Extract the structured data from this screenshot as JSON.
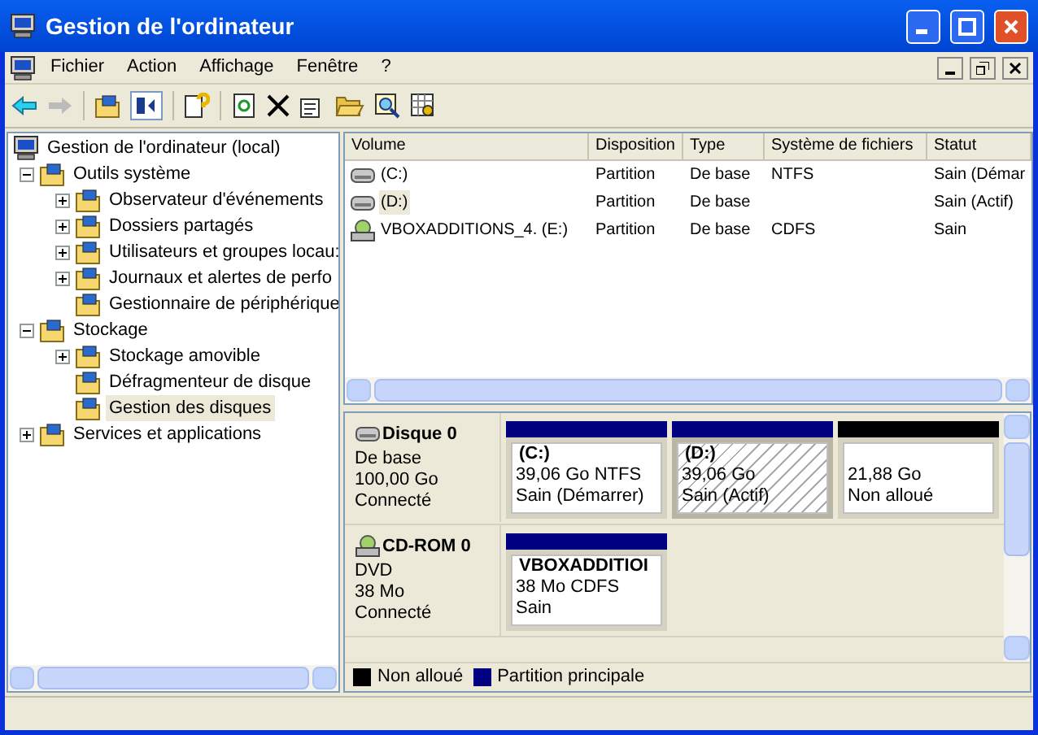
{
  "window": {
    "title": "Gestion de l'ordinateur"
  },
  "menu": [
    "Fichier",
    "Action",
    "Affichage",
    "Fenêtre",
    "?"
  ],
  "tree": [
    {
      "label": "Gestion de l'ordinateur (local)",
      "selected": false,
      "children": [
        {
          "label": "Outils système",
          "expanded": true,
          "selected": false,
          "children": [
            {
              "label": "Observateur d'événements",
              "expanded": false,
              "selected": false
            },
            {
              "label": "Dossiers partagés",
              "expanded": false,
              "selected": false
            },
            {
              "label": "Utilisateurs et groupes locau:",
              "expanded": false,
              "selected": false
            },
            {
              "label": "Journaux et alertes de perfo",
              "expanded": false,
              "selected": false
            },
            {
              "label": "Gestionnaire de périphérique",
              "selected": false
            }
          ]
        },
        {
          "label": "Stockage",
          "expanded": true,
          "selected": false,
          "children": [
            {
              "label": "Stockage amovible",
              "expanded": false,
              "selected": false
            },
            {
              "label": "Défragmenteur de disque",
              "selected": false
            },
            {
              "label": "Gestion des disques",
              "selected": true
            }
          ]
        },
        {
          "label": "Services et applications",
          "expanded": false,
          "selected": false
        }
      ]
    }
  ],
  "table": {
    "columns": [
      "Volume",
      "Disposition",
      "Type",
      "Système de fichiers",
      "Statut"
    ],
    "rows": [
      {
        "kind": "disk",
        "selected": false,
        "cells": [
          "(C:)",
          "Partition",
          "De base",
          "NTFS",
          "Sain (Démar"
        ]
      },
      {
        "kind": "disk",
        "selected": true,
        "cells": [
          "(D:)",
          "Partition",
          "De base",
          "",
          "Sain (Actif)"
        ]
      },
      {
        "kind": "cd",
        "selected": false,
        "cells": [
          "VBOXADDITIONS_4. (E:)",
          "Partition",
          "De base",
          "CDFS",
          "Sain"
        ]
      }
    ]
  },
  "disks": [
    {
      "kind": "disk",
      "name": "Disque 0",
      "lines": [
        "De base",
        "100,00 Go",
        "Connecté"
      ],
      "partitions": [
        {
          "name": "(C:)",
          "lines": [
            "39,06 Go NTFS",
            "Sain (Démarrer)"
          ],
          "color": "#000080",
          "selected": false
        },
        {
          "name": "(D:)",
          "lines": [
            "39,06 Go",
            "Sain (Actif)"
          ],
          "color": "#000080",
          "selected": true
        },
        {
          "lines": [
            "21,88 Go",
            "Non alloué"
          ],
          "color": "#000000",
          "selected": false
        }
      ]
    },
    {
      "kind": "cd",
      "name": "CD-ROM 0",
      "lines": [
        "DVD",
        "38 Mo",
        "Connecté"
      ],
      "partitions": [
        {
          "name": "VBOXADDITIOI",
          "lines": [
            "38 Mo CDFS",
            "Sain"
          ],
          "color": "#000080",
          "selected": false
        }
      ]
    }
  ],
  "legend": [
    {
      "label": "Non alloué",
      "color": "#000000"
    },
    {
      "label": "Partition principale",
      "color": "#000080"
    }
  ]
}
